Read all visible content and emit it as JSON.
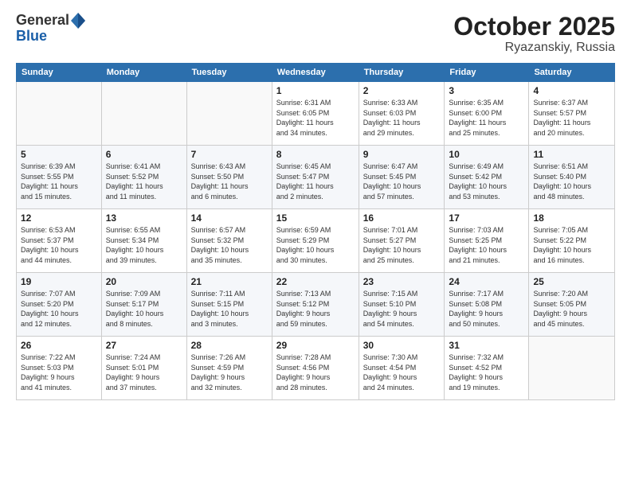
{
  "header": {
    "logo_general": "General",
    "logo_blue": "Blue",
    "month_title": "October 2025",
    "location": "Ryazanskiy, Russia"
  },
  "weekdays": [
    "Sunday",
    "Monday",
    "Tuesday",
    "Wednesday",
    "Thursday",
    "Friday",
    "Saturday"
  ],
  "weeks": [
    [
      {
        "day": "",
        "info": ""
      },
      {
        "day": "",
        "info": ""
      },
      {
        "day": "",
        "info": ""
      },
      {
        "day": "1",
        "info": "Sunrise: 6:31 AM\nSunset: 6:05 PM\nDaylight: 11 hours\nand 34 minutes."
      },
      {
        "day": "2",
        "info": "Sunrise: 6:33 AM\nSunset: 6:03 PM\nDaylight: 11 hours\nand 29 minutes."
      },
      {
        "day": "3",
        "info": "Sunrise: 6:35 AM\nSunset: 6:00 PM\nDaylight: 11 hours\nand 25 minutes."
      },
      {
        "day": "4",
        "info": "Sunrise: 6:37 AM\nSunset: 5:57 PM\nDaylight: 11 hours\nand 20 minutes."
      }
    ],
    [
      {
        "day": "5",
        "info": "Sunrise: 6:39 AM\nSunset: 5:55 PM\nDaylight: 11 hours\nand 15 minutes."
      },
      {
        "day": "6",
        "info": "Sunrise: 6:41 AM\nSunset: 5:52 PM\nDaylight: 11 hours\nand 11 minutes."
      },
      {
        "day": "7",
        "info": "Sunrise: 6:43 AM\nSunset: 5:50 PM\nDaylight: 11 hours\nand 6 minutes."
      },
      {
        "day": "8",
        "info": "Sunrise: 6:45 AM\nSunset: 5:47 PM\nDaylight: 11 hours\nand 2 minutes."
      },
      {
        "day": "9",
        "info": "Sunrise: 6:47 AM\nSunset: 5:45 PM\nDaylight: 10 hours\nand 57 minutes."
      },
      {
        "day": "10",
        "info": "Sunrise: 6:49 AM\nSunset: 5:42 PM\nDaylight: 10 hours\nand 53 minutes."
      },
      {
        "day": "11",
        "info": "Sunrise: 6:51 AM\nSunset: 5:40 PM\nDaylight: 10 hours\nand 48 minutes."
      }
    ],
    [
      {
        "day": "12",
        "info": "Sunrise: 6:53 AM\nSunset: 5:37 PM\nDaylight: 10 hours\nand 44 minutes."
      },
      {
        "day": "13",
        "info": "Sunrise: 6:55 AM\nSunset: 5:34 PM\nDaylight: 10 hours\nand 39 minutes."
      },
      {
        "day": "14",
        "info": "Sunrise: 6:57 AM\nSunset: 5:32 PM\nDaylight: 10 hours\nand 35 minutes."
      },
      {
        "day": "15",
        "info": "Sunrise: 6:59 AM\nSunset: 5:29 PM\nDaylight: 10 hours\nand 30 minutes."
      },
      {
        "day": "16",
        "info": "Sunrise: 7:01 AM\nSunset: 5:27 PM\nDaylight: 10 hours\nand 25 minutes."
      },
      {
        "day": "17",
        "info": "Sunrise: 7:03 AM\nSunset: 5:25 PM\nDaylight: 10 hours\nand 21 minutes."
      },
      {
        "day": "18",
        "info": "Sunrise: 7:05 AM\nSunset: 5:22 PM\nDaylight: 10 hours\nand 16 minutes."
      }
    ],
    [
      {
        "day": "19",
        "info": "Sunrise: 7:07 AM\nSunset: 5:20 PM\nDaylight: 10 hours\nand 12 minutes."
      },
      {
        "day": "20",
        "info": "Sunrise: 7:09 AM\nSunset: 5:17 PM\nDaylight: 10 hours\nand 8 minutes."
      },
      {
        "day": "21",
        "info": "Sunrise: 7:11 AM\nSunset: 5:15 PM\nDaylight: 10 hours\nand 3 minutes."
      },
      {
        "day": "22",
        "info": "Sunrise: 7:13 AM\nSunset: 5:12 PM\nDaylight: 9 hours\nand 59 minutes."
      },
      {
        "day": "23",
        "info": "Sunrise: 7:15 AM\nSunset: 5:10 PM\nDaylight: 9 hours\nand 54 minutes."
      },
      {
        "day": "24",
        "info": "Sunrise: 7:17 AM\nSunset: 5:08 PM\nDaylight: 9 hours\nand 50 minutes."
      },
      {
        "day": "25",
        "info": "Sunrise: 7:20 AM\nSunset: 5:05 PM\nDaylight: 9 hours\nand 45 minutes."
      }
    ],
    [
      {
        "day": "26",
        "info": "Sunrise: 7:22 AM\nSunset: 5:03 PM\nDaylight: 9 hours\nand 41 minutes."
      },
      {
        "day": "27",
        "info": "Sunrise: 7:24 AM\nSunset: 5:01 PM\nDaylight: 9 hours\nand 37 minutes."
      },
      {
        "day": "28",
        "info": "Sunrise: 7:26 AM\nSunset: 4:59 PM\nDaylight: 9 hours\nand 32 minutes."
      },
      {
        "day": "29",
        "info": "Sunrise: 7:28 AM\nSunset: 4:56 PM\nDaylight: 9 hours\nand 28 minutes."
      },
      {
        "day": "30",
        "info": "Sunrise: 7:30 AM\nSunset: 4:54 PM\nDaylight: 9 hours\nand 24 minutes."
      },
      {
        "day": "31",
        "info": "Sunrise: 7:32 AM\nSunset: 4:52 PM\nDaylight: 9 hours\nand 19 minutes."
      },
      {
        "day": "",
        "info": ""
      }
    ]
  ]
}
